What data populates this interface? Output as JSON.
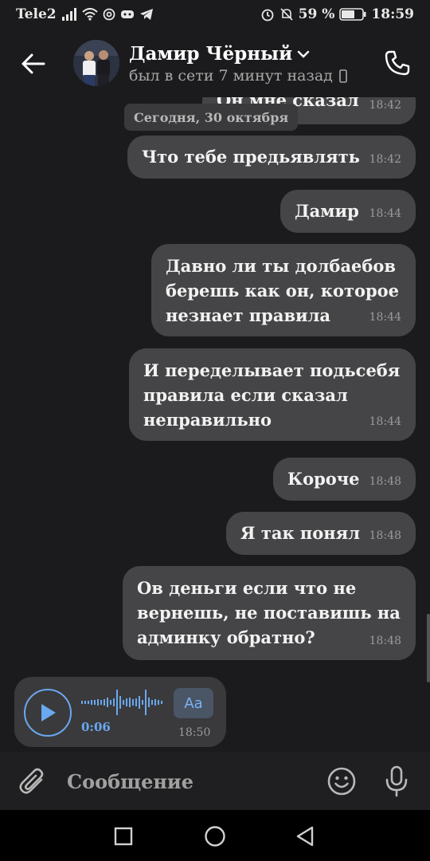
{
  "status_bar": {
    "carrier": "Tele2",
    "battery": "59 %",
    "time": "18:59"
  },
  "header": {
    "contact_name": "Дамир Чёрный",
    "last_seen": "был в сети 7 минут назад"
  },
  "chat": {
    "date_label": "Сегодня, 30 октября",
    "partial_message": {
      "text": "Он мне сказал",
      "time": "18:42"
    },
    "messages": [
      {
        "lines": [
          "Что тебе предьявлять"
        ],
        "time": "18:42"
      },
      {
        "lines": [
          "Дамир"
        ],
        "time": "18:44"
      },
      {
        "lines": [
          "Давно ли ты долбаебов",
          "берешь как он, которое",
          "незнает правила"
        ],
        "time": "18:44"
      },
      {
        "lines": [
          "И переделывает подьсебя",
          "правила если сказал",
          "неправильно"
        ],
        "time": "18:44"
      },
      {
        "lines": [
          "Короче"
        ],
        "time": "18:48"
      },
      {
        "lines": [
          "Я так понял"
        ],
        "time": "18:48"
      },
      {
        "lines": [
          "Ов деньги если что не",
          "вернешь, не поставишь на",
          "админку обратно?"
        ],
        "time": "18:48"
      }
    ],
    "voice": {
      "duration": "0:06",
      "time": "18:50",
      "transcribe_label": "Aa"
    }
  },
  "input": {
    "placeholder": "Сообщение"
  },
  "icons": {
    "back": "arrow-left-icon",
    "call": "phone-icon",
    "attach": "paperclip-icon",
    "emoji": "smile-icon",
    "mic": "microphone-icon",
    "play": "play-icon",
    "nav_recent": "square-icon",
    "nav_home": "circle-icon",
    "nav_back": "triangle-icon"
  },
  "colors": {
    "background": "#1b1b1d",
    "bubble": "#454547",
    "accent": "#6aa8f0"
  }
}
